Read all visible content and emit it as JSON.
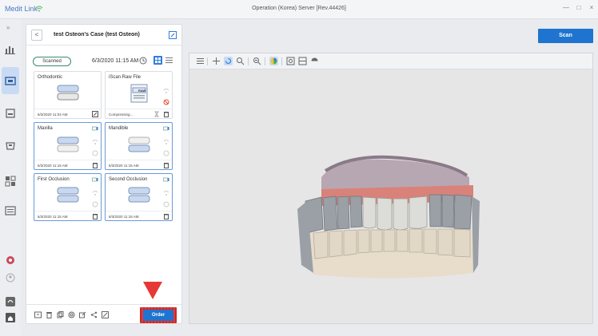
{
  "app": {
    "name": "Medit Link",
    "window_title": "Operation (Korea) Server [Rev.44426]",
    "minimize": "—",
    "maximize": "□",
    "close": "×"
  },
  "rail": {
    "expand": "»",
    "items": [
      {
        "icon": "dashboard-icon"
      },
      {
        "icon": "case-box-icon",
        "active": true
      },
      {
        "icon": "inbox-icon"
      },
      {
        "icon": "scanner-icon"
      },
      {
        "icon": "work-icon",
        "label": "Work"
      },
      {
        "icon": "list-icon"
      },
      {
        "icon": "notification-icon"
      },
      {
        "icon": "user-icon"
      },
      {
        "icon": "support-icon"
      },
      {
        "icon": "home-icon"
      }
    ]
  },
  "case": {
    "back": "<",
    "title": "test Osteon's Case (test Osteon)",
    "status": "Scanned",
    "date": "6/3/2020 11:15 AM"
  },
  "cards": [
    {
      "title": "Orthodontic",
      "date": "6/3/2020 11:04 AM"
    },
    {
      "title": "iScan Raw File",
      "date": "Compressing...",
      "badge": "RAW"
    },
    {
      "title": "Maxilla",
      "date": "6/3/2020 11:15 AM"
    },
    {
      "title": "Mandible",
      "date": "6/3/2020 11:15 AM"
    },
    {
      "title": "First Occlusion",
      "date": "6/3/2020 11:15 AM"
    },
    {
      "title": "Second Occlusion",
      "date": "6/3/2020 11:15 AM"
    }
  ],
  "toolbar": {
    "order_label": "Order",
    "scan_label": "Scan"
  },
  "colors": {
    "accent": "#1f74cf",
    "highlight": "#e53935",
    "gum": "#d9827a",
    "tooth": "#9aa0a6",
    "base": "#e8dccb"
  }
}
